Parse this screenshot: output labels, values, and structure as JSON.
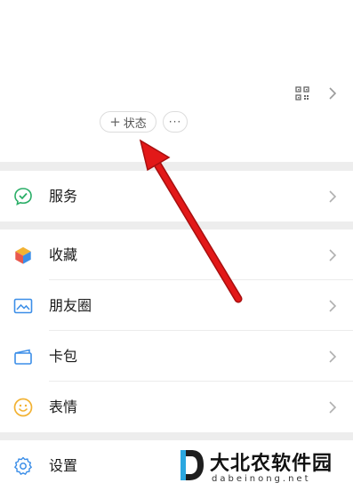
{
  "header": {
    "status_button_plus": "+",
    "status_button_label": "状态",
    "more_button_label": "···",
    "qr_icon": "qr-code-icon",
    "chevron_icon": "chevron-right-icon"
  },
  "menu": {
    "service": {
      "label": "服务",
      "icon": "service-icon"
    },
    "favorites": {
      "label": "收藏",
      "icon": "cube-icon"
    },
    "moments": {
      "label": "朋友圈",
      "icon": "image-icon"
    },
    "cards": {
      "label": "卡包",
      "icon": "wallet-icon"
    },
    "stickers": {
      "label": "表情",
      "icon": "smiley-icon"
    },
    "settings": {
      "label": "设置",
      "icon": "gear-icon"
    }
  },
  "watermark": {
    "title": "大北农软件园",
    "subtitle": "dabeinong.net"
  },
  "colors": {
    "accent_green": "#2aae67",
    "arrow_red": "#e21818",
    "section_gap": "#ededed"
  }
}
